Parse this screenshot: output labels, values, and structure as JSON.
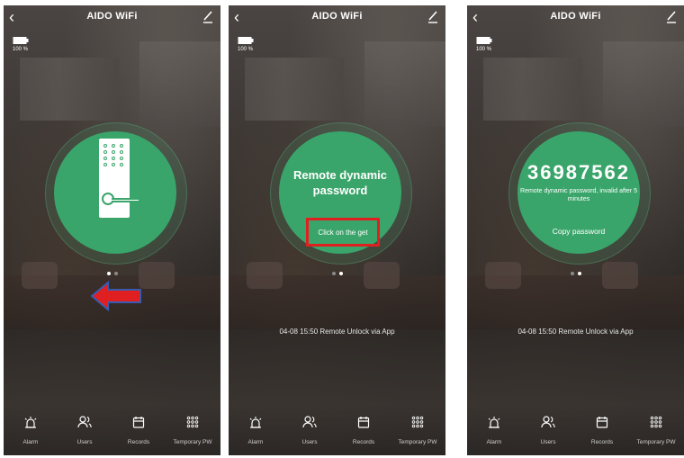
{
  "app_title": "AIDO WiFi",
  "battery": {
    "level_text": "100 %",
    "level_percent": 100
  },
  "screens": [
    {
      "dots_active": 0,
      "tabs": [
        "Alarm",
        "Users",
        "Records",
        "Temporary PW"
      ]
    },
    {
      "dots_active": 1,
      "remote_title": "Remote dynamic password",
      "get_button": "Click on the get",
      "record": "04-08 15:50  Remote Unlock via App",
      "tabs": [
        "Alarm",
        "Users",
        "Records",
        "Temporary PW"
      ]
    },
    {
      "dots_active": 1,
      "password": "36987562",
      "password_note": "Remote dynamic password, invalid after 5 minutes",
      "copy_button": "Copy password",
      "record": "04-08 15:50  Remote Unlock via App",
      "tabs": [
        "Alarm",
        "Users",
        "Records",
        "Temporary PW"
      ]
    }
  ],
  "colors": {
    "circle": "#3aa56a",
    "highlight": "#e02020",
    "arrow": "#e02020"
  },
  "icons": [
    "back-icon",
    "edit-icon",
    "battery-icon",
    "alarm-icon",
    "users-icon",
    "records-icon",
    "keypad-icon",
    "lock-icon",
    "arrow-left-icon"
  ]
}
